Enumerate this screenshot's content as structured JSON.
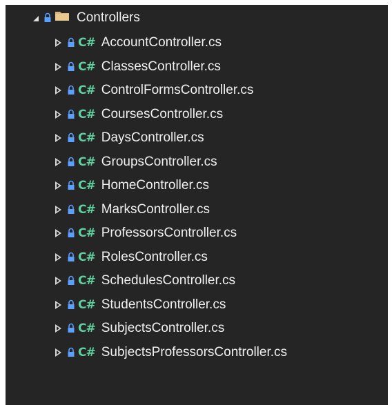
{
  "tree": {
    "folder": {
      "name": "Controllers",
      "expanded": true,
      "folder_icon": "folder-icon",
      "lock_icon": "lock-icon"
    },
    "file_icon_text": "C#",
    "files": [
      {
        "name": "AccountController.cs"
      },
      {
        "name": "ClassesController.cs"
      },
      {
        "name": "ControlFormsController.cs"
      },
      {
        "name": "CoursesController.cs"
      },
      {
        "name": "DaysController.cs"
      },
      {
        "name": "GroupsController.cs"
      },
      {
        "name": "HomeController.cs"
      },
      {
        "name": "MarksController.cs"
      },
      {
        "name": "ProfessorsController.cs"
      },
      {
        "name": "RolesController.cs"
      },
      {
        "name": "SchedulesController.cs"
      },
      {
        "name": "StudentsController.cs"
      },
      {
        "name": "SubjectsController.cs"
      },
      {
        "name": "SubjectsProfessorsController.cs"
      }
    ]
  },
  "colors": {
    "background": "#252526",
    "text": "#f0f0f0",
    "lock": "#5aa0ff",
    "csharp": "#5fd0a0",
    "folder": "#dcb67a"
  }
}
